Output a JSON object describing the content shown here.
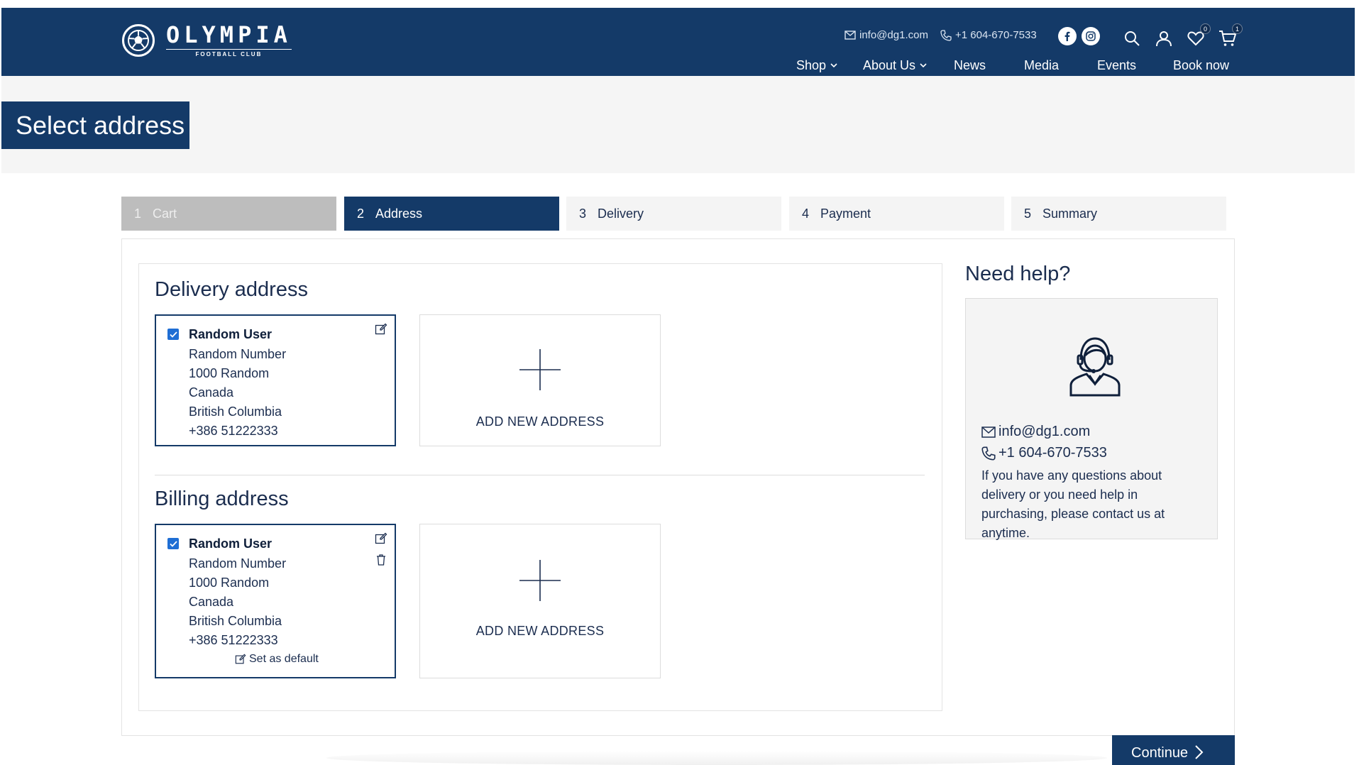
{
  "brand": {
    "name": "OLYMPIA",
    "sub": "FOOTBALL CLUB"
  },
  "header": {
    "email": "info@dg1.com",
    "phone": "+1 604-670-7533",
    "wishlist_count": "0",
    "cart_count": "1"
  },
  "nav": {
    "items": [
      "Shop",
      "About Us",
      "News",
      "Media",
      "Events",
      "Book now"
    ]
  },
  "page": {
    "title": "Select address"
  },
  "steps": [
    {
      "num": "1",
      "label": "Cart",
      "state": "done"
    },
    {
      "num": "2",
      "label": "Address",
      "state": "active"
    },
    {
      "num": "3",
      "label": "Delivery",
      "state": "todo"
    },
    {
      "num": "4",
      "label": "Payment",
      "state": "todo"
    },
    {
      "num": "5",
      "label": "Summary",
      "state": "todo"
    }
  ],
  "delivery": {
    "title": "Delivery address",
    "address": {
      "name": "Random User",
      "lines": [
        "Random Number",
        "1000 Random",
        "Canada",
        "British Columbia",
        "+386  51222333"
      ],
      "selected": true
    },
    "add_label": "ADD NEW ADDRESS"
  },
  "billing": {
    "title": "Billing address",
    "address": {
      "name": "Random User",
      "lines": [
        "Random Number",
        "1000 Random",
        "Canada",
        "British Columbia",
        "+386  51222333"
      ],
      "selected": true
    },
    "set_default_label": "Set as default",
    "add_label": "ADD NEW ADDRESS"
  },
  "help": {
    "title": "Need help?",
    "email": "info@dg1.com",
    "phone": "+1 604-670-7533",
    "text": "If you have any questions about delivery or you need help in purchasing, please contact us at anytime."
  },
  "continue_label": "Continue",
  "colors": {
    "primary": "#143a68",
    "checkbox": "#1f6ed4",
    "step_done": "#bdbdbd",
    "panel_bg": "#f4f4f4"
  }
}
